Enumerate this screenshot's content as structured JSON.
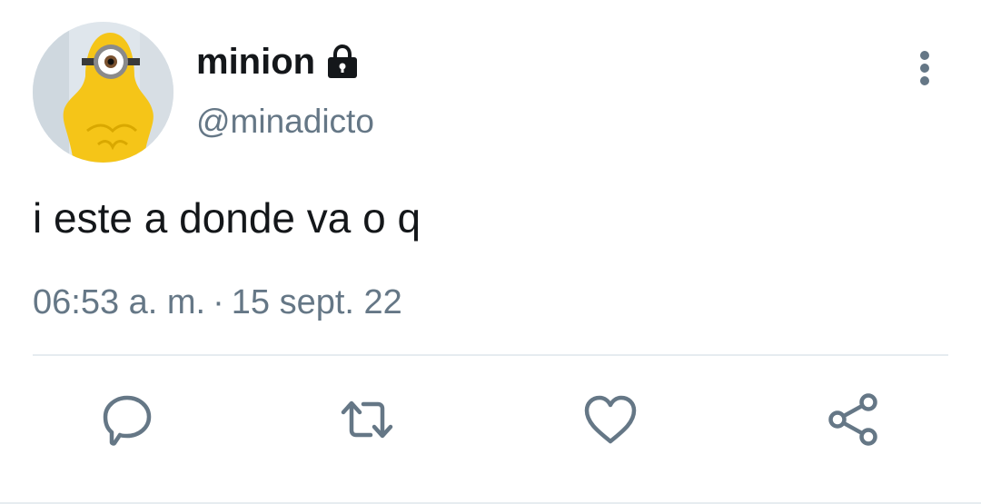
{
  "user": {
    "display_name": "minion",
    "handle": "@minadicto",
    "protected_icon": "lock-icon"
  },
  "tweet": {
    "text": "i este a donde va o q",
    "time": "06:53 a. m.",
    "separator": "·",
    "date": "15 sept. 22"
  },
  "actions": [
    {
      "icon": "reply-icon"
    },
    {
      "icon": "retweet-icon"
    },
    {
      "icon": "like-icon"
    },
    {
      "icon": "share-icon"
    }
  ],
  "colors": {
    "text_primary": "#14171a",
    "text_secondary": "#657786",
    "icon": "#657786",
    "divider": "#e6ecf0"
  }
}
